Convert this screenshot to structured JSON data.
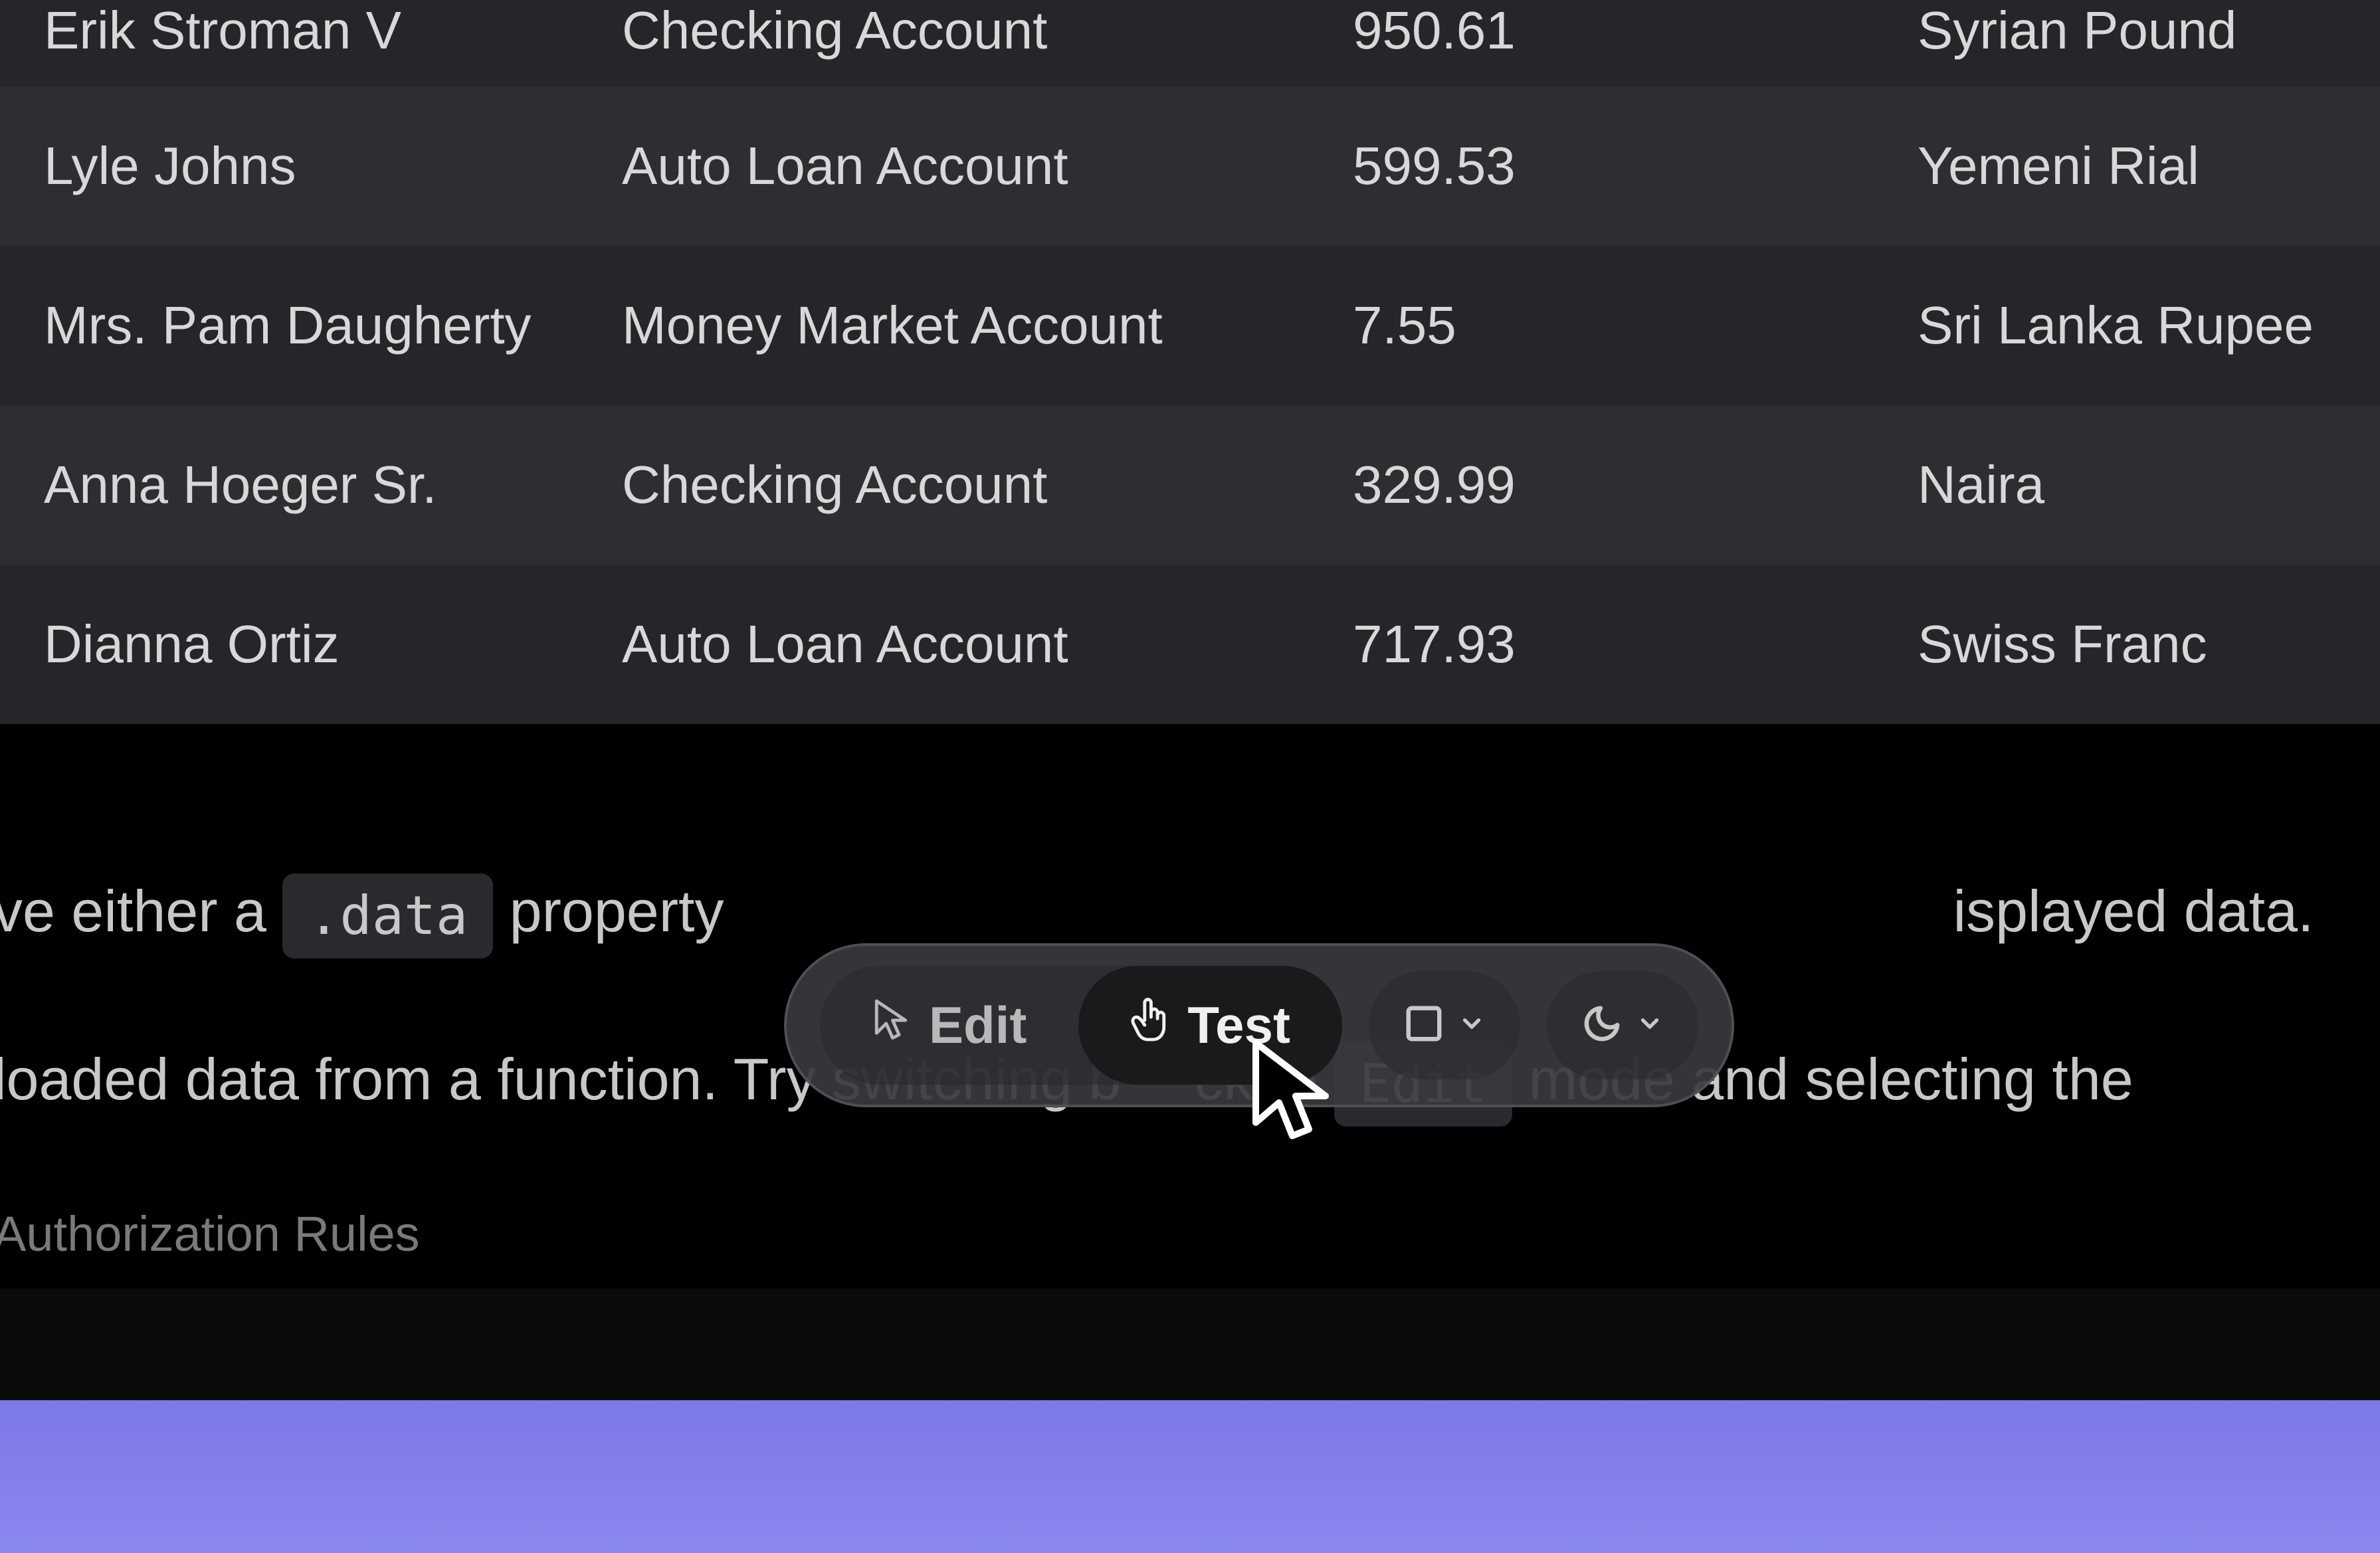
{
  "table": {
    "rows": [
      {
        "name": "Erik Stroman V",
        "account": "Checking Account",
        "amount": "950.61",
        "currency": "Syrian Pound"
      },
      {
        "name": "Lyle Johns",
        "account": "Auto Loan Account",
        "amount": "599.53",
        "currency": "Yemeni Rial"
      },
      {
        "name": "Mrs. Pam Daugherty",
        "account": "Money Market Account",
        "amount": "7.55",
        "currency": "Sri Lanka Rupee"
      },
      {
        "name": "Anna Hoeger Sr.",
        "account": "Checking Account",
        "amount": "329.99",
        "currency": "Naira"
      },
      {
        "name": "Dianna Ortiz",
        "account": "Auto Loan Account",
        "amount": "717.93",
        "currency": "Swiss Franc"
      }
    ]
  },
  "description": {
    "line1_prefix": "ve either a ",
    "line1_code": ".data",
    "line1_mid": " property",
    "line1_suffix": "isplayed data.",
    "line2_prefix": " loaded data from a function. Try switching b",
    "line2_mid": "ck to ",
    "line2_code": "Edit",
    "line2_suffix": " mode and selecting the ",
    "auth_rules": " Authorization Rules"
  },
  "toolbar": {
    "edit_label": "Edit",
    "test_label": "Test"
  }
}
